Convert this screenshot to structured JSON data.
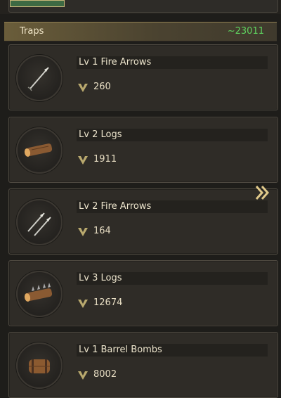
{
  "section": {
    "title": "Traps",
    "total": "~23011"
  },
  "items": [
    {
      "name": "Lv 1 Fire Arrows",
      "power": "260",
      "icon": "fire-arrows-icon"
    },
    {
      "name": "Lv 2 Logs",
      "power": "1911",
      "icon": "logs-icon"
    },
    {
      "name": "Lv 2 Fire Arrows",
      "power": "164",
      "icon": "fire-arrows-icon"
    },
    {
      "name": "Lv 3 Logs",
      "power": "12674",
      "icon": "spiked-logs-icon"
    },
    {
      "name": "Lv 1 Barrel Bombs",
      "power": "8002",
      "icon": "barrel-bombs-icon"
    }
  ],
  "colors": {
    "accent_green": "#5fd35f",
    "gold": "#c9b77a"
  }
}
